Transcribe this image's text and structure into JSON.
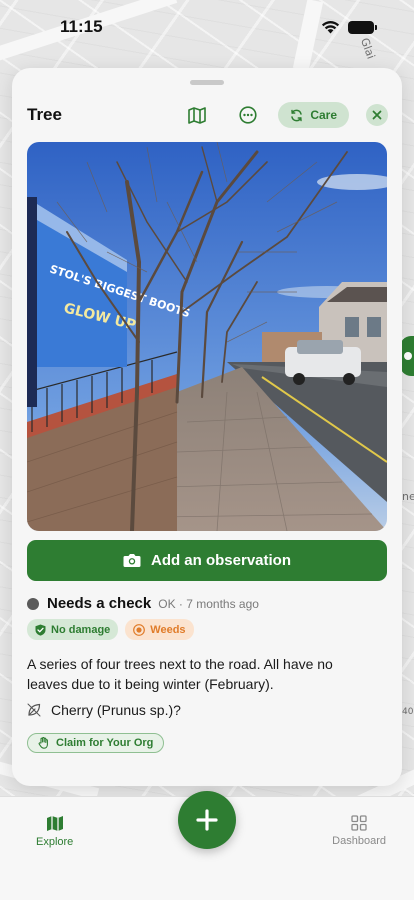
{
  "status_bar": {
    "time": "11:15"
  },
  "map": {
    "labels": [
      "Glai",
      "ne",
      "40"
    ]
  },
  "card": {
    "title": "Tree",
    "care_label": "Care",
    "observation_button": "Add an observation",
    "status": {
      "label": "Needs a check",
      "meta": "OK · 7 months ago"
    },
    "badges": [
      {
        "label": "No damage",
        "icon": "shield-check-icon"
      },
      {
        "label": "Weeds",
        "icon": "weed-icon"
      }
    ],
    "description": "A series of four trees next to the road. All have no leaves due to it being winter (February).",
    "species": "Cherry (Prunus sp.)?",
    "claim_button": "Claim for Your Org",
    "photo_banner_text": [
      "STOL'S BIGGEST BOOTS",
      "GLOW UP"
    ]
  },
  "tab_bar": {
    "explore_label": "Explore",
    "dashboard_label": "Dashboard"
  },
  "colors": {
    "accent": "#2e7d32",
    "accent_light": "#cfe3d0",
    "warning": "#e07c2a",
    "status_dot": "#5a5a5a"
  }
}
